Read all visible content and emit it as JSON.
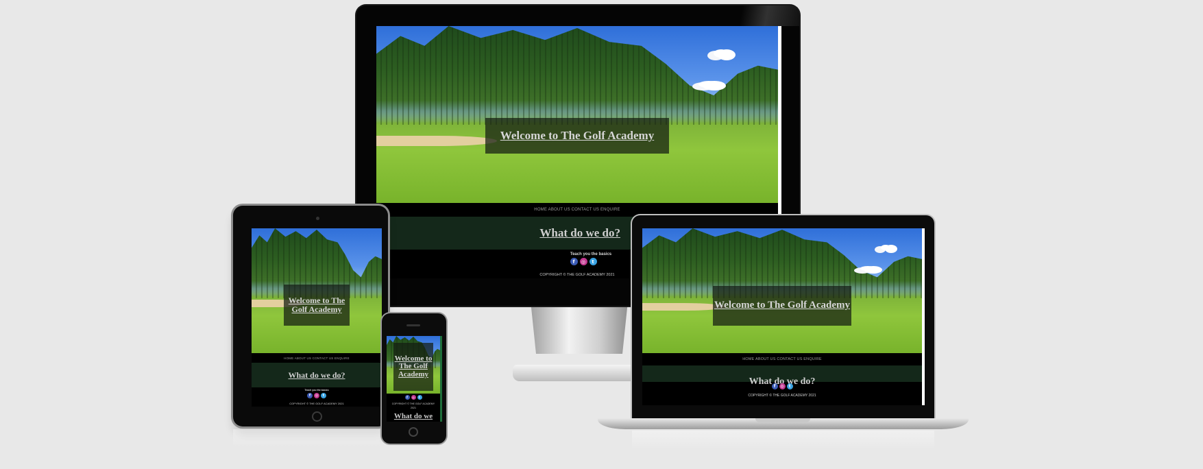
{
  "site": {
    "hero_title": "Welcome to The Golf Academy",
    "hero_title_lines_tablet": "Welcome to The Golf Academy",
    "nav": "HOME ABOUT US CONTACT US ENQUIRE",
    "section_title": "What do we do?",
    "section_title_phone_partial": "What do we",
    "tagline": "Teach you the basics",
    "copyright": "COPYRIGHT © THE GOLF ACADEMY 2021",
    "socials": [
      {
        "name": "facebook-icon",
        "glyph": "f"
      },
      {
        "name": "instagram-icon",
        "glyph": "◎"
      },
      {
        "name": "twitter-icon",
        "glyph": "t"
      }
    ]
  },
  "colors": {
    "page_bg": "#e8e8e8",
    "band_bg": "#14281a",
    "hero_box": "rgba(20,28,18,0.72)",
    "facebook": "#3b5bb5",
    "instagram": "#c2368f",
    "twitter": "#3aa3e3"
  }
}
